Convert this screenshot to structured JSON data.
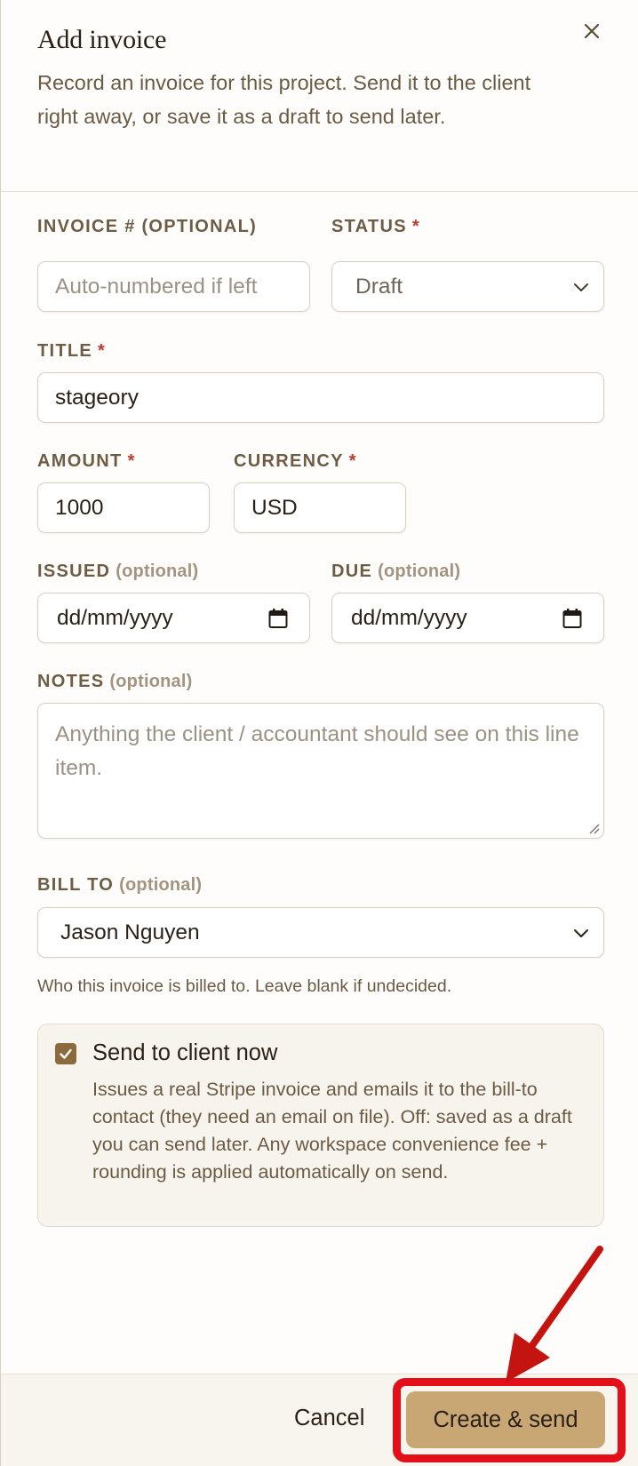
{
  "dialog": {
    "title": "Add invoice",
    "description": "Record an invoice for this project. Send it to the client right away, or save it as a draft to send later."
  },
  "icons": {
    "close": "close-icon",
    "select_chevron": "chevron-down-icon",
    "calendar": "calendar-icon",
    "checkbox_check": "check-icon"
  },
  "form": {
    "invoice_number": {
      "label": "INVOICE # (OPTIONAL)",
      "placeholder": "Auto-numbered if left",
      "value": ""
    },
    "status": {
      "label": "STATUS",
      "required_mark": "*",
      "value": "Draft"
    },
    "title": {
      "label": "TITLE",
      "required_mark": "*",
      "value": "stageory"
    },
    "amount": {
      "label": "AMOUNT",
      "required_mark": "*",
      "value": "1000"
    },
    "currency": {
      "label": "CURRENCY",
      "required_mark": "*",
      "value": "USD"
    },
    "issued": {
      "label": "ISSUED",
      "optional_mark": "(optional)",
      "placeholder": "dd/mm/yyyy"
    },
    "due": {
      "label": "DUE",
      "optional_mark": "(optional)",
      "placeholder": "dd/mm/yyyy"
    },
    "notes": {
      "label": "NOTES",
      "optional_mark": "(optional)",
      "placeholder": "Anything the client / accountant should see on this line item."
    },
    "bill_to": {
      "label": "BILL TO",
      "optional_mark": "(optional)",
      "value": "Jason Nguyen",
      "hint": "Who this invoice is billed to. Leave blank if undecided."
    },
    "send_now": {
      "checked": true,
      "label": "Send to client now",
      "description": "Issues a real Stripe invoice and emails it to the bill-to contact (they need an email on file). Off: saved as a draft you can send later. Any workspace convenience fee + rounding is applied automatically on send."
    }
  },
  "footer": {
    "cancel_label": "Cancel",
    "submit_label": "Create & send"
  },
  "colors": {
    "accent": "#c8a774",
    "checkbox": "#8b6a3e",
    "required": "#c0392b",
    "annotation": "#e3101a"
  }
}
